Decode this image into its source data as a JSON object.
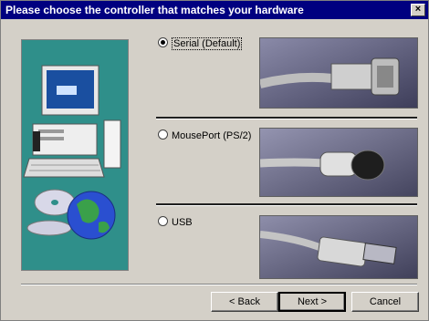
{
  "window": {
    "title": "Please choose the controller that matches your hardware",
    "close_glyph": "×"
  },
  "options": [
    {
      "label": "Serial (Default)",
      "selected": true
    },
    {
      "label": "MousePort (PS/2)",
      "selected": false
    },
    {
      "label": "USB",
      "selected": false
    }
  ],
  "buttons": {
    "back": "< Back",
    "next": "Next >",
    "cancel": "Cancel"
  },
  "colors": {
    "titlebar": "#000080",
    "dialog_face": "#d4d0c8",
    "panel_teal": "#2f8f8a"
  }
}
